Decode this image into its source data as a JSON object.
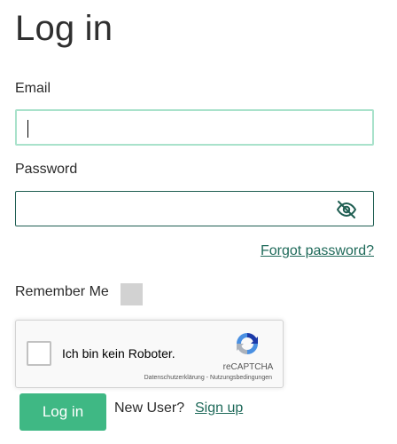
{
  "page": {
    "title": "Log in"
  },
  "form": {
    "email": {
      "label": "Email",
      "value": "",
      "placeholder": ""
    },
    "password": {
      "label": "Password",
      "value": "",
      "placeholder": "",
      "toggle_icon": "eye-slash-icon"
    },
    "forgot_password": "Forgot password?",
    "remember_me": {
      "label": "Remember Me",
      "checked": false
    }
  },
  "recaptcha": {
    "label": "Ich bin kein Roboter.",
    "brand": "reCAPTCHA",
    "terms": "Datenschutzerklärung - Nutzungsbedingungen",
    "checked": false
  },
  "actions": {
    "login_label": "Log in",
    "new_user_text": "New User?",
    "signup_label": "Sign up"
  },
  "colors": {
    "accent": "#3fb884",
    "link": "#1f6a5a",
    "focus_border": "#a9e2cb",
    "input_border": "#1f5e52"
  }
}
